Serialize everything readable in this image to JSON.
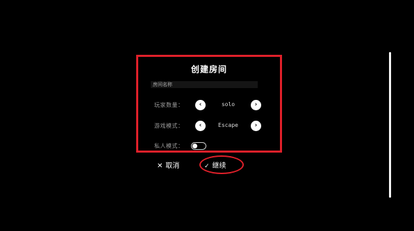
{
  "dialog": {
    "title": "创建房间",
    "room_name_placeholder": "房间名称",
    "players": {
      "label": "玩家数量：",
      "value": "solo",
      "prev_icon": "‹",
      "next_icon": "›"
    },
    "mode": {
      "label": "游戏模式：",
      "value": "Escape",
      "prev_icon": "‹",
      "next_icon": "›"
    },
    "private": {
      "label": "私人模式：",
      "enabled": false
    }
  },
  "actions": {
    "cancel_icon": "✕",
    "cancel_label": "取消",
    "continue_icon": "✓",
    "continue_label": "继续"
  },
  "colors": {
    "background": "#000000",
    "highlight": "#e0202a",
    "text": "#ffffff"
  }
}
